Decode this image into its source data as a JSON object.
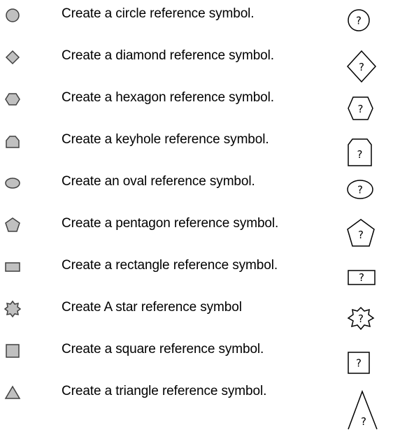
{
  "colors": {
    "button_fill": "#c0c0c0",
    "button_stroke": "#404040",
    "symbol_stroke": "#000000"
  },
  "symbol_glyph": "?",
  "items": [
    {
      "shape": "circle",
      "icon": "circle-icon",
      "description": "Create a circle reference symbol."
    },
    {
      "shape": "diamond",
      "icon": "diamond-icon",
      "description": "Create a diamond reference symbol."
    },
    {
      "shape": "hexagon",
      "icon": "hexagon-icon",
      "description": "Create a hexagon reference symbol."
    },
    {
      "shape": "keyhole",
      "icon": "keyhole-icon",
      "description": "Create a keyhole reference symbol."
    },
    {
      "shape": "oval",
      "icon": "oval-icon",
      "description": "Create an oval reference symbol."
    },
    {
      "shape": "pentagon",
      "icon": "pentagon-icon",
      "description": "Create a pentagon reference symbol."
    },
    {
      "shape": "rectangle",
      "icon": "rectangle-icon",
      "description": "Create a rectangle reference symbol."
    },
    {
      "shape": "star",
      "icon": "star-icon",
      "description": "Create A star reference symbol"
    },
    {
      "shape": "square",
      "icon": "square-icon",
      "description": "Create a square reference symbol."
    },
    {
      "shape": "triangle",
      "icon": "triangle-icon",
      "description": "Create a triangle reference symbol."
    }
  ]
}
